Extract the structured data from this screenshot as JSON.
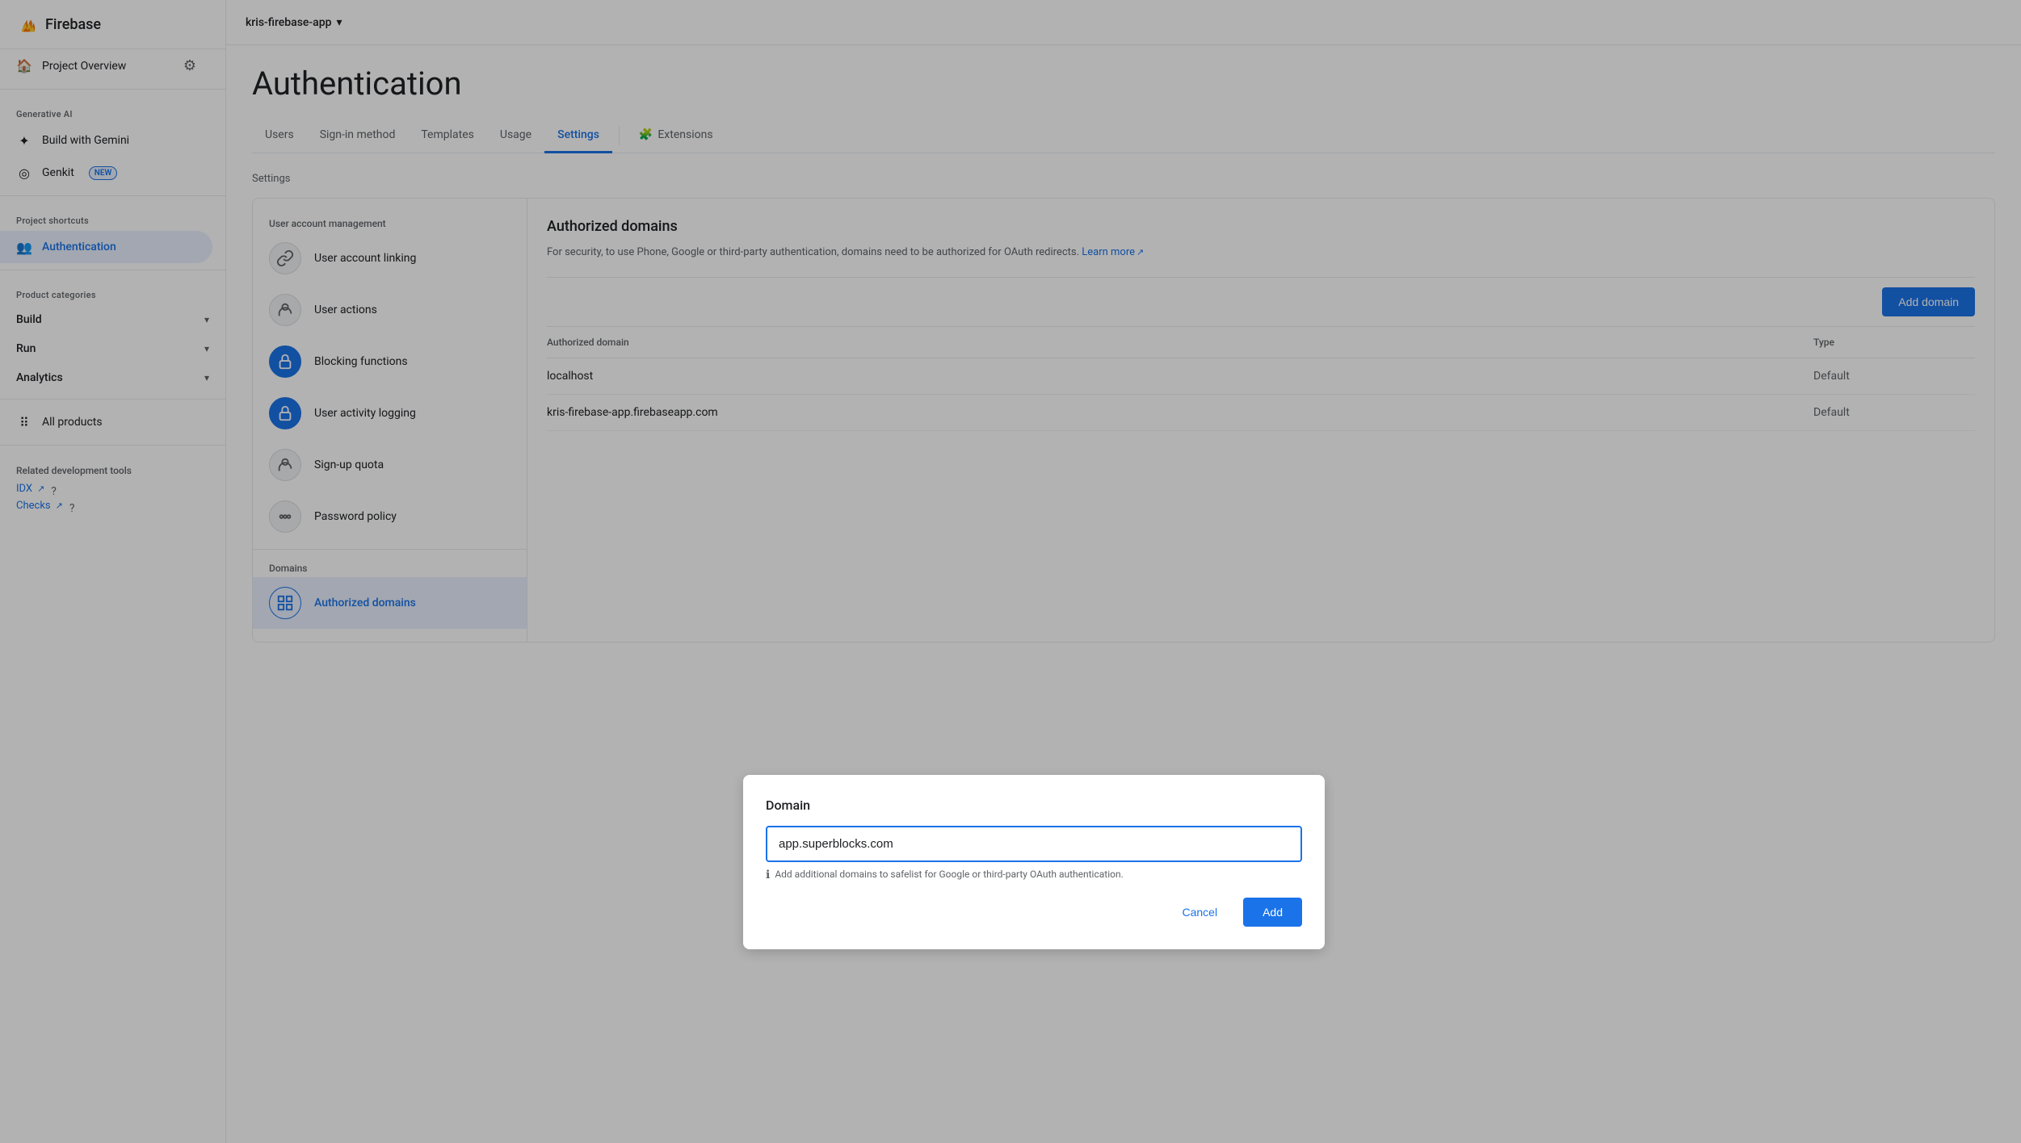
{
  "app": {
    "name": "Firebase",
    "project": "kris-firebase-app"
  },
  "sidebar": {
    "generative_ai_label": "Generative AI",
    "build_with_gemini": "Build with Gemini",
    "genkit": "Genkit",
    "genkit_badge": "NEW",
    "project_shortcuts_label": "Project shortcuts",
    "home_label": "Project Overview",
    "authentication_label": "Authentication",
    "product_categories_label": "Product categories",
    "build_label": "Build",
    "run_label": "Run",
    "analytics_label": "Analytics",
    "all_products_label": "All products",
    "related_tools_label": "Related development tools",
    "idx_label": "IDX",
    "checks_label": "Checks"
  },
  "page": {
    "title": "Authentication"
  },
  "tabs": [
    {
      "label": "Users",
      "active": false
    },
    {
      "label": "Sign-in method",
      "active": false
    },
    {
      "label": "Templates",
      "active": false
    },
    {
      "label": "Usage",
      "active": false
    },
    {
      "label": "Settings",
      "active": true
    },
    {
      "label": "Extensions",
      "active": false
    }
  ],
  "settings_section_label": "Settings",
  "settings_nav": {
    "user_account_mgmt_label": "User account management",
    "items": [
      {
        "id": "user-account-linking",
        "label": "User account linking",
        "icon": "🔗",
        "icon_type": "outline"
      },
      {
        "id": "user-actions",
        "label": "User actions",
        "icon": "👤",
        "icon_type": "outline"
      },
      {
        "id": "blocking-functions",
        "label": "Blocking functions",
        "icon": "🔒",
        "icon_type": "blue"
      },
      {
        "id": "user-activity-logging",
        "label": "User activity logging",
        "icon": "🔒",
        "icon_type": "blue"
      },
      {
        "id": "sign-up-quota",
        "label": "Sign-up quota",
        "icon": "👤",
        "icon_type": "outline"
      },
      {
        "id": "password-policy",
        "label": "Password policy",
        "icon": "···",
        "icon_type": "outline"
      }
    ],
    "domains_label": "Domains",
    "domain_items": [
      {
        "id": "authorized-domains",
        "label": "Authorized domains",
        "icon": "⊞",
        "icon_type": "active"
      }
    ]
  },
  "authorized_domains": {
    "title": "Authorized domains",
    "description": "For security, to use Phone, Google or third-party authentication, domains need to be authorized for OAuth redirects.",
    "learn_more": "Learn more",
    "add_domain_button": "Add domain",
    "col_domain": "Authorized domain",
    "col_type": "Type",
    "domains": [
      {
        "domain": "localhost",
        "type": "Default"
      },
      {
        "domain": "kris-firebase-app.firebaseapp.com",
        "type": "Default"
      }
    ]
  },
  "dialog": {
    "title": "Domain",
    "input_value": "app.superblocks.com",
    "input_placeholder": "app.superblocks.com",
    "hint": "Add additional domains to safelist for Google or third-party OAuth authentication.",
    "cancel_label": "Cancel",
    "add_label": "Add"
  }
}
